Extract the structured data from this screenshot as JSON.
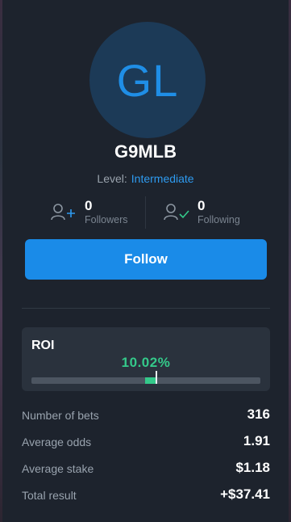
{
  "profile": {
    "initials": "GL",
    "username": "G9MLB",
    "level_label": "Level:",
    "level_value": "Intermediate"
  },
  "stats": {
    "followers_count": "0",
    "followers_label": "Followers",
    "following_count": "0",
    "following_label": "Following"
  },
  "follow_label": "Follow",
  "roi": {
    "title": "ROI",
    "value": "10.02%",
    "percent": 10.02
  },
  "summary": [
    {
      "label": "Number of bets",
      "value": "316"
    },
    {
      "label": "Average odds",
      "value": "1.91"
    },
    {
      "label": "Average stake",
      "value": "$1.18"
    },
    {
      "label": "Total result",
      "value": "+$37.41"
    }
  ],
  "colors": {
    "accent": "#1a8be8",
    "roi_green": "#34c98a",
    "avatar_bg": "#1c3a57"
  }
}
